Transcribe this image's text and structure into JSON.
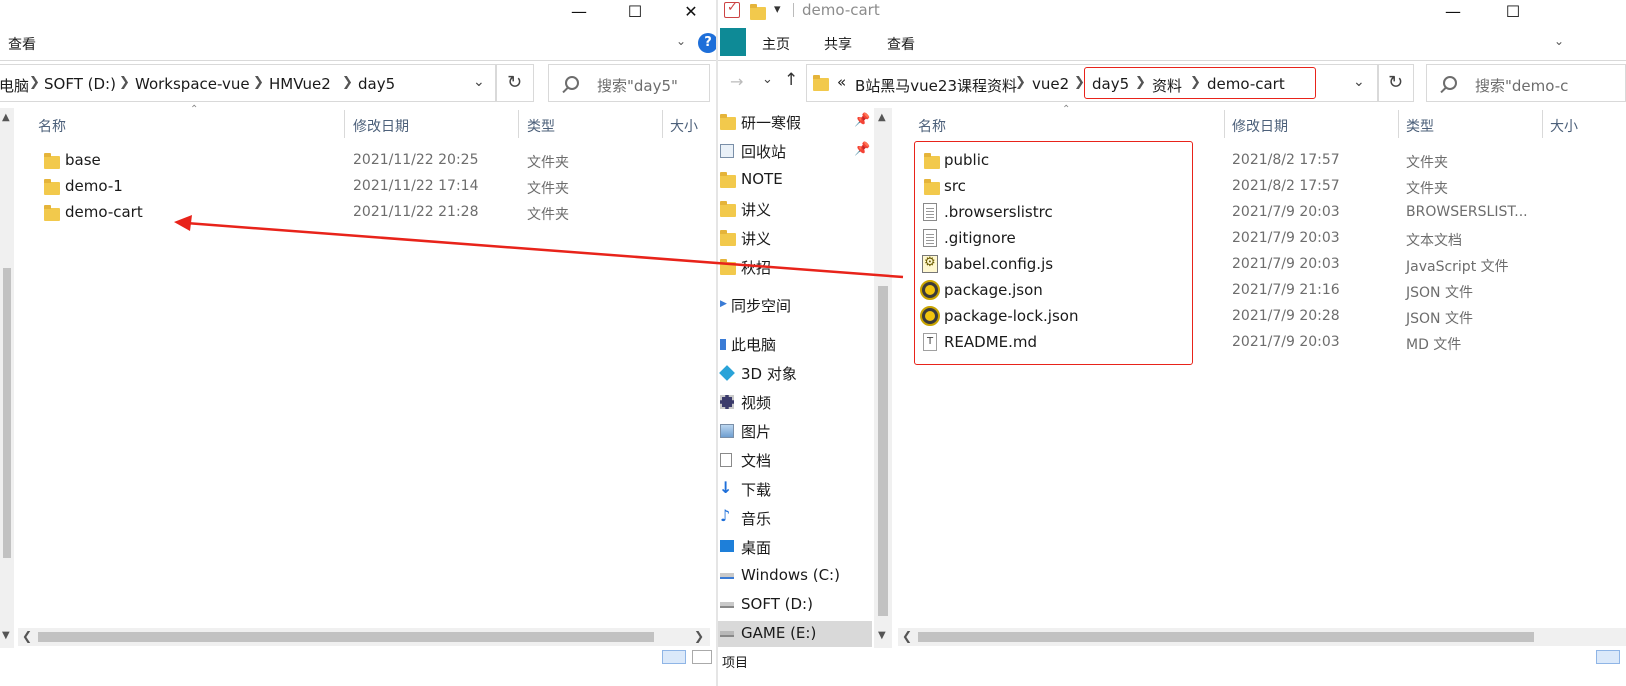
{
  "left_window": {
    "menu_view": "查看",
    "breadcrumb": [
      "电脑",
      "SOFT (D:)",
      "Workspace-vue",
      "HMVue2",
      "day5"
    ],
    "search_placeholder": "搜索\"day5\"",
    "columns": {
      "name": "名称",
      "modified": "修改日期",
      "type": "类型",
      "size": "大小"
    },
    "files": [
      {
        "name": "base",
        "modified": "2021/11/22 20:25",
        "type": "文件夹",
        "icon": "folder-icon"
      },
      {
        "name": "demo-1",
        "modified": "2021/11/22 17:14",
        "type": "文件夹",
        "icon": "folder-icon"
      },
      {
        "name": "demo-cart",
        "modified": "2021/11/22 21:28",
        "type": "文件夹",
        "icon": "folder-icon"
      }
    ]
  },
  "right_window": {
    "title": "demo-cart",
    "ribbon_tabs": [
      "主页",
      "共享",
      "查看"
    ],
    "breadcrumb": [
      "«",
      "B站黑马vue23课程资料",
      "vue2",
      "day5",
      "资料",
      "demo-cart"
    ],
    "search_placeholder": "搜索\"demo-c",
    "columns": {
      "name": "名称",
      "modified": "修改日期",
      "type": "类型",
      "size": "大小"
    },
    "files": [
      {
        "name": "public",
        "modified": "2021/8/2 17:57",
        "type": "文件夹",
        "icon": "folder-icon"
      },
      {
        "name": "src",
        "modified": "2021/8/2 17:57",
        "type": "文件夹",
        "icon": "folder-icon"
      },
      {
        "name": ".browserslistrc",
        "modified": "2021/7/9 20:03",
        "type": "BROWSERSLIST...",
        "icon": "file-icon"
      },
      {
        "name": ".gitignore",
        "modified": "2021/7/9 20:03",
        "type": "文本文档",
        "icon": "text-file-icon"
      },
      {
        "name": "babel.config.js",
        "modified": "2021/7/9 20:03",
        "type": "JavaScript 文件",
        "icon": "js-file-icon"
      },
      {
        "name": "package.json",
        "modified": "2021/7/9 21:16",
        "type": "JSON 文件",
        "icon": "json-file-icon"
      },
      {
        "name": "package-lock.json",
        "modified": "2021/7/9 20:28",
        "type": "JSON 文件",
        "icon": "json-file-icon"
      },
      {
        "name": "README.md",
        "modified": "2021/7/9 20:03",
        "type": "MD 文件",
        "icon": "markdown-file-icon"
      }
    ]
  },
  "nav_pane": {
    "items": [
      {
        "label": "研一寒假",
        "icon": "folder-icon",
        "pinned": true
      },
      {
        "label": "回收站",
        "icon": "recycle-bin-icon",
        "pinned": true
      },
      {
        "label": "NOTE",
        "icon": "folder-icon",
        "pinned": false
      },
      {
        "label": "讲义",
        "icon": "folder-icon",
        "pinned": false
      },
      {
        "label": "讲义",
        "icon": "folder-icon",
        "pinned": false
      },
      {
        "label": "秋招",
        "icon": "folder-icon",
        "pinned": false
      },
      {
        "label": "同步空间",
        "icon": "cloud-icon",
        "pinned": false
      },
      {
        "label": "此电脑",
        "icon": "computer-icon",
        "pinned": false
      },
      {
        "label": "3D 对象",
        "icon": "3d-objects-icon",
        "pinned": false
      },
      {
        "label": "视频",
        "icon": "video-icon",
        "pinned": false
      },
      {
        "label": "图片",
        "icon": "pictures-icon",
        "pinned": false
      },
      {
        "label": "文档",
        "icon": "documents-icon",
        "pinned": false
      },
      {
        "label": "下载",
        "icon": "download-icon",
        "pinned": false
      },
      {
        "label": "音乐",
        "icon": "music-icon",
        "pinned": false
      },
      {
        "label": "桌面",
        "icon": "desktop-icon",
        "pinned": false
      },
      {
        "label": "Windows (C:)",
        "icon": "drive-icon",
        "pinned": false
      },
      {
        "label": "SOFT (D:)",
        "icon": "drive-icon",
        "pinned": false
      },
      {
        "label": "GAME (E:)",
        "icon": "drive-icon",
        "pinned": false
      }
    ],
    "status_partial": "项目"
  },
  "colors": {
    "highlight_red": "#e8231a",
    "folder_yellow": "#f2c94c",
    "header_text": "#4c607a",
    "help_blue": "#1e6fd9",
    "teal_accent": "#0e8a96"
  }
}
